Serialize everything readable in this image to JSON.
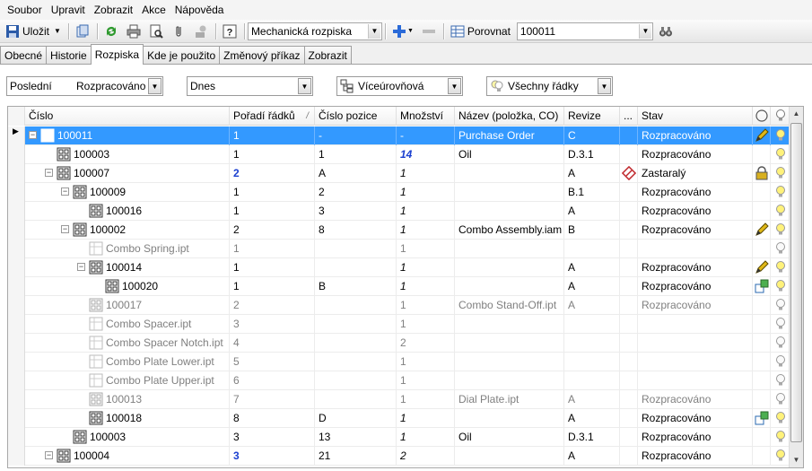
{
  "menu": [
    "Soubor",
    "Upravit",
    "Zobrazit",
    "Akce",
    "Nápověda"
  ],
  "toolbar": {
    "save_label": "Uložit",
    "view_combo": "Mechanická rozpiska",
    "compare_label": "Porovnat",
    "compare_value": "100011"
  },
  "tabs": [
    "Obecné",
    "Historie",
    "Rozpiska",
    "Kde je použito",
    "Změnový příkaz",
    "Zobrazit"
  ],
  "active_tab": "Rozpiska",
  "filters": {
    "version_a": "Poslední",
    "version_b": "Rozpracováno",
    "date": "Dnes",
    "levels": "Víceúrovňová",
    "rows": "Všechny řádky"
  },
  "columns": {
    "cislo": "Číslo",
    "poradi": "Pořadí řádků",
    "sort_marker": "/",
    "pozice": "Číslo pozice",
    "mnozstvi": "Množství",
    "nazev": "Název (položka, CO)",
    "revize": "Revize",
    "dots": "...",
    "stav": "Stav"
  },
  "rows": [
    {
      "level": 0,
      "exp": "-",
      "icon": "assembly",
      "cislo": "100011",
      "poradi": "1",
      "pozice": "-",
      "mnozstvi": "-",
      "nazev": "Purchase Order",
      "revize": "C",
      "stav": "Rozpracováno",
      "flag": "pencil",
      "selected": true,
      "gray": false
    },
    {
      "level": 1,
      "exp": "",
      "icon": "assembly",
      "cislo": "100003",
      "poradi": "1",
      "pozice": "1",
      "mnozstvi": "14",
      "qtyBlue": true,
      "nazev": "Oil",
      "revize": "D.3.1",
      "stav": "Rozpracováno",
      "flag": "",
      "gray": false
    },
    {
      "level": 1,
      "exp": "-",
      "icon": "assembly",
      "cislo": "100007",
      "poradi": "2",
      "poradiBlue": true,
      "pozice": "A",
      "mnozstvi": "1",
      "nazev": "",
      "revize": "A",
      "stav": "Zastaralý",
      "obsolete": true,
      "flag": "lock",
      "gray": false
    },
    {
      "level": 2,
      "exp": "-",
      "icon": "assembly",
      "cislo": "100009",
      "poradi": "1",
      "pozice": "2",
      "mnozstvi": "1",
      "nazev": "",
      "revize": "B.1",
      "stav": "Rozpracováno",
      "flag": "",
      "gray": false
    },
    {
      "level": 3,
      "exp": "",
      "icon": "assembly",
      "cislo": "100016",
      "poradi": "1",
      "pozice": "3",
      "mnozstvi": "1",
      "nazev": "",
      "revize": "A",
      "stav": "Rozpracováno",
      "flag": "",
      "gray": false
    },
    {
      "level": 2,
      "exp": "-",
      "icon": "assembly",
      "cislo": "100002",
      "poradi": "2",
      "pozice": "8",
      "mnozstvi": "1",
      "nazev": "Combo Assembly.iam",
      "revize": "B",
      "stav": "Rozpracováno",
      "flag": "pencil",
      "gray": false
    },
    {
      "level": 3,
      "exp": "",
      "icon": "file",
      "cislo": "Combo Spring.ipt",
      "poradi": "1",
      "pozice": "",
      "mnozstvi": "1",
      "nazev": "",
      "revize": "",
      "stav": "",
      "flag": "",
      "gray": true
    },
    {
      "level": 3,
      "exp": "-",
      "icon": "assembly",
      "cislo": "100014",
      "poradi": "1",
      "pozice": "",
      "mnozstvi": "1",
      "nazev": "",
      "revize": "A",
      "stav": "Rozpracováno",
      "flag": "pencil",
      "gray": false
    },
    {
      "level": 4,
      "exp": "",
      "icon": "assembly",
      "cislo": "100020",
      "poradi": "1",
      "pozice": "B",
      "mnozstvi": "1",
      "nazev": "",
      "revize": "A",
      "stav": "Rozpracováno",
      "flag": "struct",
      "gray": false
    },
    {
      "level": 3,
      "exp": "",
      "icon": "assembly-gray",
      "cislo": "100017",
      "poradi": "2",
      "pozice": "",
      "mnozstvi": "1",
      "nazev": "Combo Stand-Off.ipt",
      "revize": "A",
      "stav": "Rozpracováno",
      "flag": "",
      "gray": true
    },
    {
      "level": 3,
      "exp": "",
      "icon": "file",
      "cislo": "Combo Spacer.ipt",
      "poradi": "3",
      "pozice": "",
      "mnozstvi": "1",
      "nazev": "",
      "revize": "",
      "stav": "",
      "flag": "",
      "gray": true
    },
    {
      "level": 3,
      "exp": "",
      "icon": "file",
      "cislo": "Combo Spacer Notch.ipt",
      "poradi": "4",
      "pozice": "",
      "mnozstvi": "2",
      "nazev": "",
      "revize": "",
      "stav": "",
      "flag": "",
      "gray": true
    },
    {
      "level": 3,
      "exp": "",
      "icon": "file",
      "cislo": "Combo Plate Lower.ipt",
      "poradi": "5",
      "pozice": "",
      "mnozstvi": "1",
      "nazev": "",
      "revize": "",
      "stav": "",
      "flag": "",
      "gray": true
    },
    {
      "level": 3,
      "exp": "",
      "icon": "file",
      "cislo": "Combo Plate Upper.ipt",
      "poradi": "6",
      "pozice": "",
      "mnozstvi": "1",
      "nazev": "",
      "revize": "",
      "stav": "",
      "flag": "",
      "gray": true
    },
    {
      "level": 3,
      "exp": "",
      "icon": "assembly-gray",
      "cislo": "100013",
      "poradi": "7",
      "pozice": "",
      "mnozstvi": "1",
      "nazev": "Dial Plate.ipt",
      "revize": "A",
      "stav": "Rozpracováno",
      "flag": "",
      "gray": true
    },
    {
      "level": 3,
      "exp": "",
      "icon": "assembly",
      "cislo": "100018",
      "poradi": "8",
      "pozice": "D",
      "mnozstvi": "1",
      "nazev": "",
      "revize": "A",
      "stav": "Rozpracováno",
      "flag": "struct",
      "gray": false
    },
    {
      "level": 2,
      "exp": "",
      "icon": "assembly",
      "cislo": "100003",
      "poradi": "3",
      "pozice": "13",
      "mnozstvi": "1",
      "nazev": "Oil",
      "revize": "D.3.1",
      "stav": "Rozpracováno",
      "flag": "",
      "gray": false
    },
    {
      "level": 1,
      "exp": "-",
      "icon": "assembly",
      "cislo": "100004",
      "poradi": "3",
      "poradiBlue": true,
      "pozice": "21",
      "mnozstvi": "2",
      "nazev": "",
      "revize": "A",
      "stav": "Rozpracováno",
      "flag": "",
      "gray": false
    }
  ]
}
